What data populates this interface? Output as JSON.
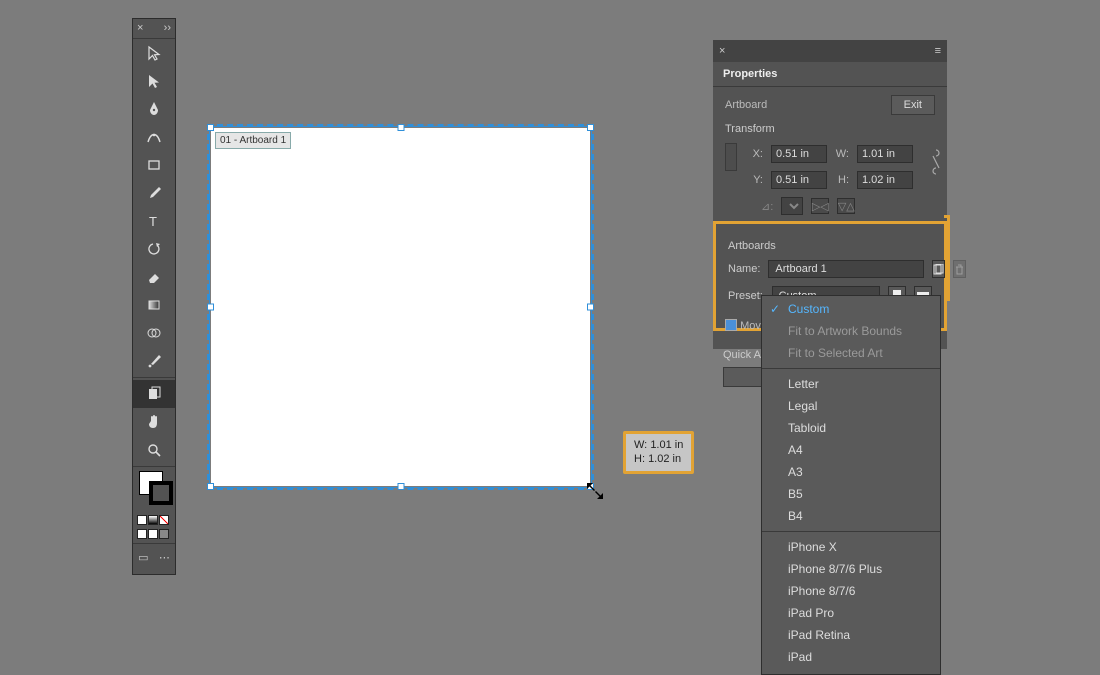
{
  "toolbar": {
    "tooltips": {
      "selection": "Selection Tool",
      "direct": "Direct Selection Tool",
      "pen": "Pen Tool",
      "curvature": "Curvature Tool",
      "rect": "Rectangle Tool",
      "brush": "Paintbrush Tool",
      "type": "Type Tool",
      "rotate": "Rotate Tool",
      "eraser": "Eraser Tool",
      "gradient": "Gradient Tool",
      "shapebuilder": "Shape Builder Tool",
      "eyedropper": "Eyedropper Tool",
      "artboard": "Artboard Tool",
      "hand": "Hand Tool",
      "zoom": "Zoom Tool"
    }
  },
  "artboard": {
    "label": "01 - Artboard 1"
  },
  "dim_badge": {
    "w_label": "W:",
    "w_value": "1.01 in",
    "h_label": "H:",
    "h_value": "1.02 in"
  },
  "panel": {
    "title": "Properties",
    "object_type": "Artboard",
    "exit": "Exit",
    "transform": {
      "title": "Transform",
      "x_label": "X:",
      "x": "0.51 in",
      "y_label": "Y:",
      "y": "0.51 in",
      "w_label": "W:",
      "w": "1.01 in",
      "h_label": "H:",
      "h": "1.02 in",
      "angle_label": "⊿:"
    },
    "artboards": {
      "title": "Artboards",
      "name_label": "Name:",
      "name": "Artboard 1",
      "preset_label": "Preset:",
      "preset": "Custom"
    },
    "move_checkbox": "Move",
    "quick_actions": "Quick Act"
  },
  "dropdown": {
    "items": [
      {
        "label": "Custom",
        "selected": true
      },
      {
        "label": "Fit to Artwork Bounds",
        "muted": true
      },
      {
        "label": "Fit to Selected Art",
        "muted": true
      },
      {
        "sep": true
      },
      {
        "label": "Letter"
      },
      {
        "label": "Legal"
      },
      {
        "label": "Tabloid"
      },
      {
        "label": "A4"
      },
      {
        "label": "A3"
      },
      {
        "label": "B5"
      },
      {
        "label": "B4"
      },
      {
        "sep": true
      },
      {
        "label": "iPhone X"
      },
      {
        "label": "iPhone 8/7/6 Plus"
      },
      {
        "label": "iPhone 8/7/6"
      },
      {
        "label": "iPad Pro"
      },
      {
        "label": "iPad Retina"
      },
      {
        "label": "iPad"
      }
    ]
  }
}
